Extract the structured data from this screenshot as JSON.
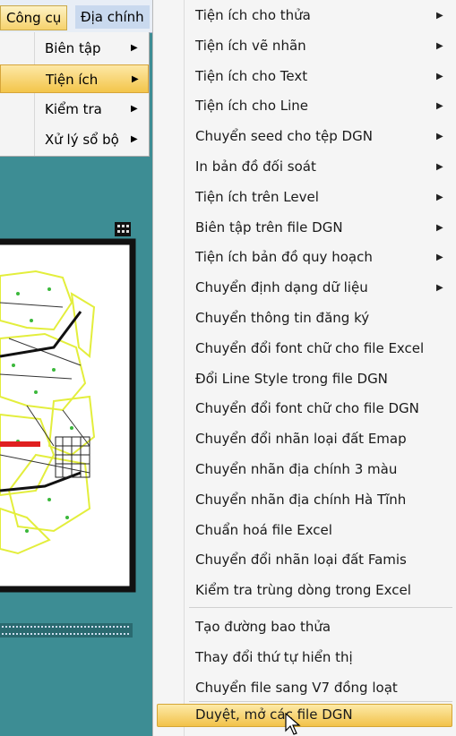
{
  "menubar": {
    "items": [
      {
        "label": "Công cụ",
        "active": true
      },
      {
        "label": "Địa chính",
        "active": false
      }
    ]
  },
  "submenu1": {
    "items": [
      {
        "label": "Biên tập",
        "has_submenu": true
      },
      {
        "label": "Tiện ích",
        "has_submenu": true,
        "highlighted": true
      },
      {
        "label": "Kiểm tra",
        "has_submenu": true
      },
      {
        "label": "Xử lý sổ bộ",
        "has_submenu": true
      }
    ]
  },
  "submenu2": {
    "items": [
      {
        "label": "Tiện ích cho thửa",
        "has_submenu": true
      },
      {
        "label": "Tiện ích vẽ nhãn",
        "has_submenu": true
      },
      {
        "label": "Tiện ích cho Text",
        "has_submenu": true
      },
      {
        "label": "Tiện ích cho Line",
        "has_submenu": true
      },
      {
        "label": "Chuyển seed cho tệp DGN",
        "has_submenu": true
      },
      {
        "label": "In bản đồ đối soát",
        "has_submenu": true
      },
      {
        "label": "Tiện ích trên Level",
        "has_submenu": true
      },
      {
        "label": "Biên tập trên file DGN",
        "has_submenu": true
      },
      {
        "label": "Tiện ích bản đồ quy hoạch",
        "has_submenu": true
      },
      {
        "label": "Chuyển định dạng dữ liệu",
        "has_submenu": true
      },
      {
        "label": "Chuyển thông tin đăng ký",
        "has_submenu": false
      },
      {
        "label": "Chuyển đổi font chữ cho file Excel",
        "has_submenu": false
      },
      {
        "label": "Đổi Line Style trong file DGN",
        "has_submenu": false
      },
      {
        "label": "Chuyển đổi font chữ cho file DGN",
        "has_submenu": false
      },
      {
        "label": "Chuyển đổi nhãn loại đất Emap",
        "has_submenu": false
      },
      {
        "label": "Chuyển nhãn địa chính 3 màu",
        "has_submenu": false
      },
      {
        "label": "Chuyển nhãn địa chính Hà Tĩnh",
        "has_submenu": false
      },
      {
        "label": "Chuẩn hoá file Excel",
        "has_submenu": false
      },
      {
        "label": "Chuyển đổi nhãn loại đất Famis",
        "has_submenu": false
      },
      {
        "label": "Kiểm tra trùng dòng trong Excel",
        "has_submenu": false
      },
      {
        "label": "Tạo đường bao thửa",
        "has_submenu": false
      },
      {
        "label": "Thay đổi thứ tự hiển thị",
        "has_submenu": false
      },
      {
        "label": "Chuyển file sang V7 đồng loạt",
        "has_submenu": false
      },
      {
        "label": "Duyệt, mở các file DGN",
        "has_submenu": false,
        "highlighted": true
      }
    ]
  },
  "colors": {
    "background": "#3d8d94",
    "highlight": "#f3c54a",
    "menu_bg": "#f5f5f5",
    "map_parcels": "#e8f25a",
    "map_frame": "#111111"
  }
}
